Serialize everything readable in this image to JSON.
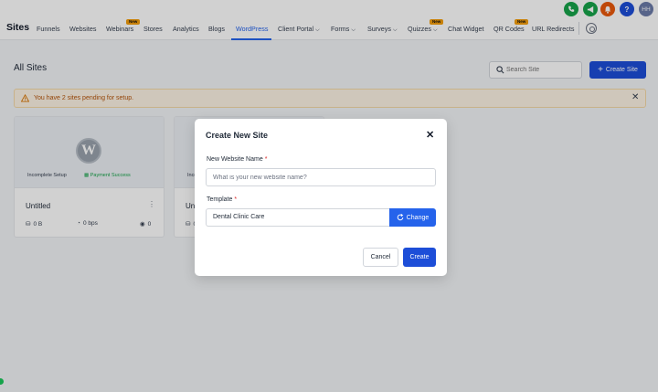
{
  "topbar": {
    "title": "Sites",
    "nav": [
      {
        "label": "Funnels"
      },
      {
        "label": "Websites"
      },
      {
        "label": "Webinars",
        "badge": "New"
      },
      {
        "label": "Stores"
      },
      {
        "label": "Analytics"
      },
      {
        "label": "Blogs"
      },
      {
        "label": "WordPress",
        "active": true
      },
      {
        "label": "Client Portal",
        "dropdown": true
      },
      {
        "label": "Forms",
        "dropdown": true
      },
      {
        "label": "Surveys",
        "dropdown": true
      },
      {
        "label": "Quizzes",
        "badge": "New",
        "dropdown": true
      },
      {
        "label": "Chat Widget"
      },
      {
        "label": "QR Codes",
        "badge": "New"
      },
      {
        "label": "URL Redirects"
      }
    ],
    "icons": {
      "phone": "phone-icon",
      "megaphone": "megaphone-icon",
      "bell": "bell-icon",
      "help": "?",
      "avatar": "HH"
    },
    "colors": {
      "phone": "#16a34a",
      "megaphone": "#16a34a",
      "bell": "#ea580c",
      "help": "#1d4ed8",
      "avatar": "#6b7aa8",
      "accent": "#2563eb"
    }
  },
  "page": {
    "title": "All Sites",
    "search_placeholder": "Search Site",
    "create_button": "Create Site",
    "alert": "You have 2 sites pending for setup."
  },
  "cards": [
    {
      "setup_status": "Incomplete Setup",
      "payment_status": "Payment Success",
      "name": "Untitled",
      "storage": "0 B",
      "bandwidth": "0 bps",
      "views": "0"
    },
    {
      "setup_status": "Inco",
      "name": "Unt",
      "storage": "0"
    }
  ],
  "modal": {
    "title": "Create New Site",
    "name_label": "New Website Name",
    "name_placeholder": "What is your new website name?",
    "template_label": "Template",
    "template_value": "Dental Clinic Care",
    "change_button": "Change",
    "cancel_button": "Cancel",
    "create_button": "Create",
    "required_mark": "*"
  }
}
